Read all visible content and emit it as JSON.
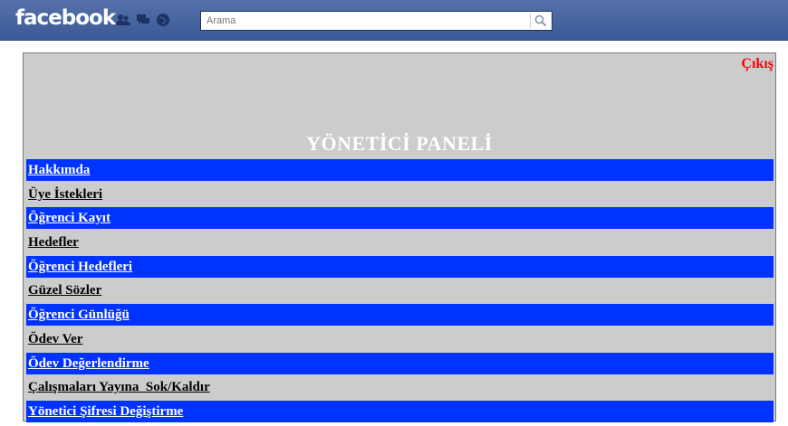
{
  "header": {
    "logo": "facebook",
    "search_placeholder": "Arama",
    "icons": [
      "friend-requests-icon",
      "messages-icon",
      "notifications-icon",
      "search-icon"
    ]
  },
  "panel": {
    "logout": "Çıkış",
    "title": "YÖNETİCİ PANELİ",
    "menu": [
      "Hakkımda",
      "Üye İstekleri",
      "Öğrenci Kayıt",
      "Hedefler",
      "Öğrenci Hedefleri",
      "Güzel Sözler",
      "Öğrenci Günlüğü",
      "Ödev Ver",
      "Ödev Değerlendirme",
      "Çalışmaları Yayına  Sok/Kaldır",
      "Yönetici Şifresi Değiştirme"
    ]
  },
  "colors": {
    "fb_blue": "#3b5998",
    "panel_bg": "#cccccc",
    "row_blue": "#0033ff",
    "logout_red": "#ff0000"
  }
}
